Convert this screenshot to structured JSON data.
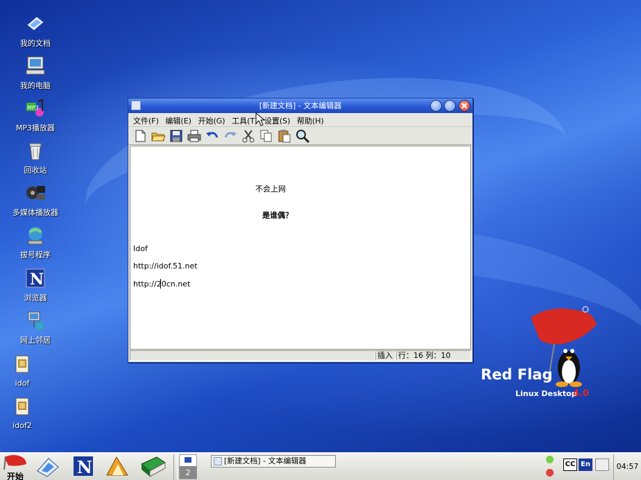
{
  "desktop": {
    "icons": [
      {
        "label": "我的文档",
        "icon": "my-documents-icon"
      },
      {
        "label": "我的电脑",
        "icon": "computer-icon"
      },
      {
        "label": "MP3播放器",
        "icon": "mp3-player-icon"
      },
      {
        "label": "回收站",
        "icon": "trash-icon"
      },
      {
        "label": "多媒体播放器",
        "icon": "media-player-icon"
      },
      {
        "label": "拔号程序",
        "icon": "dialup-icon"
      },
      {
        "label": "浏览器",
        "icon": "browser-icon"
      },
      {
        "label": "网上邻居",
        "icon": "network-icon"
      },
      {
        "label": "idof",
        "icon": "file-icon"
      },
      {
        "label": "idof2",
        "icon": "file-icon"
      }
    ],
    "brand": {
      "name": "Red Flag",
      "tagline": "Linux Desktop",
      "version": "4.0"
    }
  },
  "window": {
    "title": "[新建文档] - 文本编辑器",
    "menu": [
      "文件(F)",
      "编辑(E)",
      "开始(G)",
      "工具(T)",
      "设置(S)",
      "帮助(H)"
    ],
    "toolbar": [
      "new-file-icon",
      "open-folder-icon",
      "save-icon",
      "print-icon",
      "undo-icon",
      "redo-icon",
      "cut-icon",
      "copy-icon",
      "paste-icon",
      "find-icon"
    ],
    "content": {
      "line1": "不会上网",
      "line2": "是谁偶？",
      "line3": "Idof",
      "line4": "http://idof.51.net",
      "line5": "http://20cn.net"
    },
    "status": {
      "mode": "插入",
      "position": "行：16 列：10"
    }
  },
  "taskbar": {
    "start_label": "开始",
    "pager_number": "2",
    "task_label": "[新建文档] - 文本编辑器",
    "clock": "04:57",
    "lang_label": "En"
  }
}
